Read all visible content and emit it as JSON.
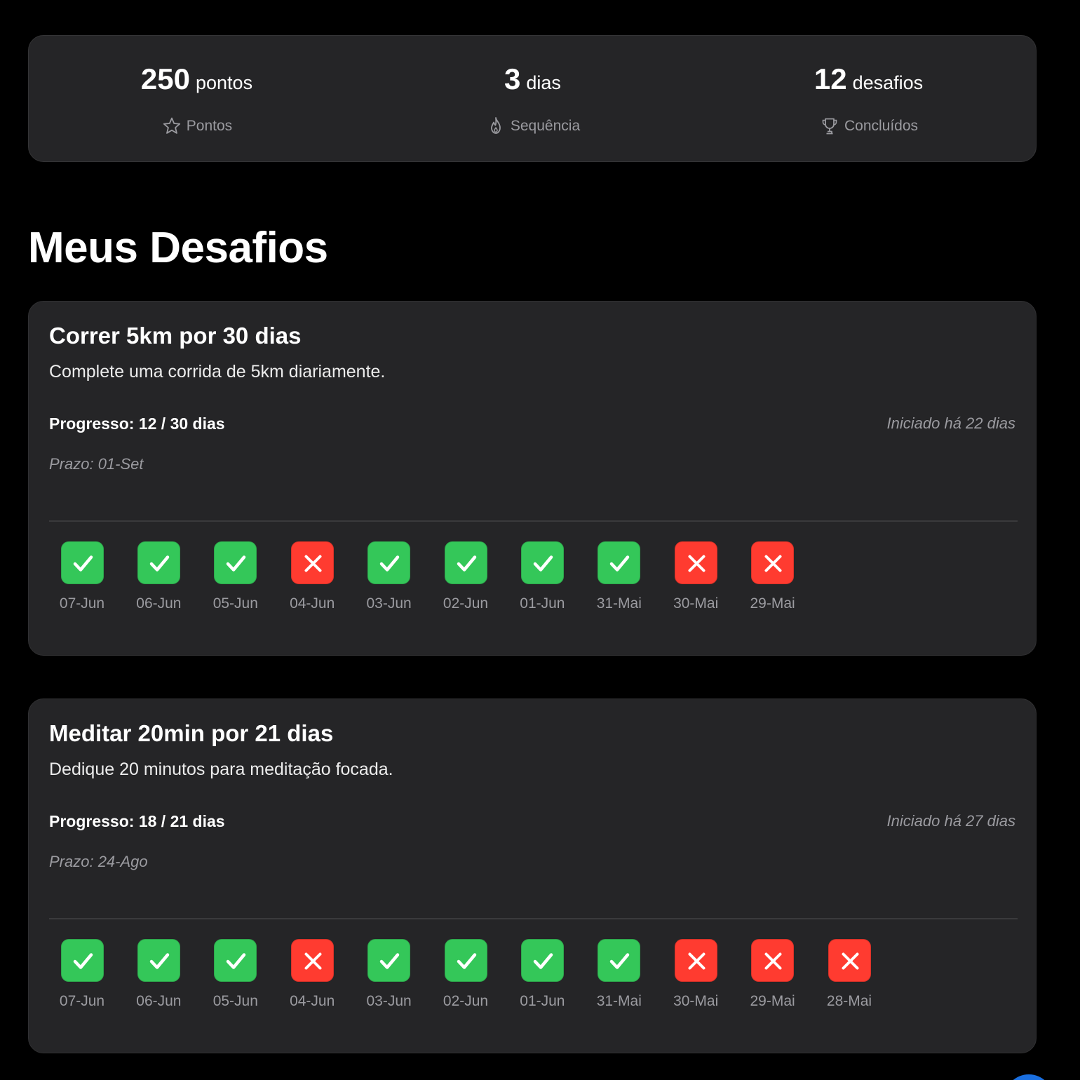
{
  "stats": [
    {
      "value": "250",
      "unit": "pontos",
      "label": "Pontos",
      "icon": "star-icon"
    },
    {
      "value": "3",
      "unit": "dias",
      "label": "Sequência",
      "icon": "flame-icon"
    },
    {
      "value": "12",
      "unit": "desafios",
      "label": "Concluídos",
      "icon": "trophy-icon"
    }
  ],
  "section_title": "Meus Desafios",
  "challenges": [
    {
      "title": "Correr 5km por 30 dias",
      "description": "Complete uma corrida de 5km diariamente.",
      "progress": "Progresso: 12 / 30 dias",
      "started": "Iniciado há 22 dias",
      "deadline": "Prazo: 01-Set",
      "days": [
        {
          "date": "07-Jun",
          "status": "done"
        },
        {
          "date": "06-Jun",
          "status": "done"
        },
        {
          "date": "05-Jun",
          "status": "done"
        },
        {
          "date": "04-Jun",
          "status": "missed"
        },
        {
          "date": "03-Jun",
          "status": "done"
        },
        {
          "date": "02-Jun",
          "status": "done"
        },
        {
          "date": "01-Jun",
          "status": "done"
        },
        {
          "date": "31-Mai",
          "status": "done"
        },
        {
          "date": "30-Mai",
          "status": "missed"
        },
        {
          "date": "29-Mai",
          "status": "missed"
        }
      ]
    },
    {
      "title": "Meditar 20min por 21 dias",
      "description": "Dedique 20 minutos para meditação focada.",
      "progress": "Progresso: 18 / 21 dias",
      "started": "Iniciado há 27 dias",
      "deadline": "Prazo: 24-Ago",
      "days": [
        {
          "date": "07-Jun",
          "status": "done"
        },
        {
          "date": "06-Jun",
          "status": "done"
        },
        {
          "date": "05-Jun",
          "status": "done"
        },
        {
          "date": "04-Jun",
          "status": "missed"
        },
        {
          "date": "03-Jun",
          "status": "done"
        },
        {
          "date": "02-Jun",
          "status": "done"
        },
        {
          "date": "01-Jun",
          "status": "done"
        },
        {
          "date": "31-Mai",
          "status": "done"
        },
        {
          "date": "30-Mai",
          "status": "missed"
        },
        {
          "date": "29-Mai",
          "status": "missed"
        },
        {
          "date": "28-Mai",
          "status": "missed"
        }
      ]
    }
  ],
  "colors": {
    "background": "#000000",
    "card": "#252527",
    "done": "#34c759",
    "missed": "#ff3b30",
    "muted_text": "#9b9ba0"
  }
}
